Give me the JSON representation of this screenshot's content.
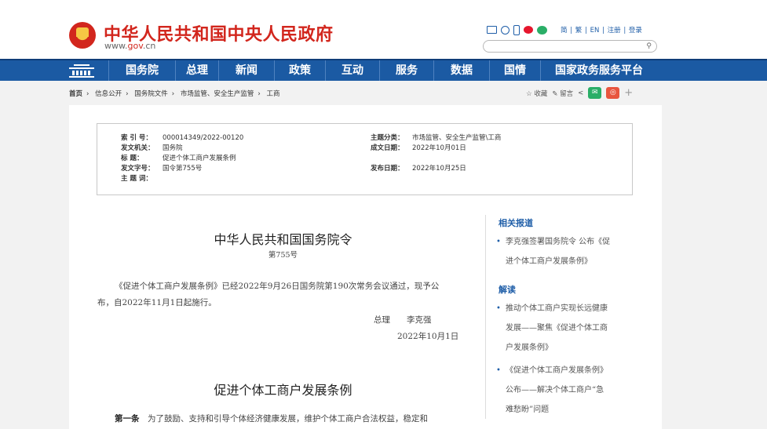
{
  "header": {
    "site_title": "中华人民共和国中央人民政府",
    "site_url_prefix": "www.",
    "site_url_brand": "gov",
    "site_url_suffix": ".cn",
    "top_links": [
      "简",
      "繁",
      "EN",
      "注册",
      "登录"
    ],
    "search_placeholder": ""
  },
  "nav": {
    "items": [
      "国务院",
      "总理",
      "新闻",
      "政策",
      "互动",
      "服务",
      "数据",
      "国情",
      "国家政务服务平台"
    ]
  },
  "breadcrumb": [
    "首页",
    "信息公开",
    "国务院文件",
    "市场监管、安全生产监管",
    "工商"
  ],
  "tools": {
    "favorite": "☆ 收藏",
    "comment": "✎ 留言",
    "share": "<",
    "wechat": "✉",
    "weibo": "◎",
    "more": "+"
  },
  "meta": {
    "index_no_label": "索 引 号：",
    "index_no": "000014349/2022-00120",
    "issuer_label": "发文机关：",
    "issuer": "国务院",
    "title_label": "标    题：",
    "title": "促进个体工商户发展条例",
    "doc_no_label": "发文字号：",
    "doc_no": "国令第755号",
    "keywords_label": "主 题 词：",
    "keywords": "",
    "category_label": "主题分类：",
    "category": "市场监管、安全生产监管\\工商",
    "written_label": "成文日期：",
    "written": "2022年10月01日",
    "published_label": "发布日期：",
    "published": "2022年10月25日"
  },
  "document": {
    "order_title": "中华人民共和国国务院令",
    "order_no": "第755号",
    "intro_line1": "《促进个体工商户发展条例》已经2022年9月26日国务院第190次常务会议通过，现予公",
    "intro_line2": "布，自2022年11月1日起施行。",
    "signer": "总理　　李克强",
    "sign_date": "2022年10月1日",
    "regulation_title": "促进个体工商户发展条例",
    "article1_head": "第一条",
    "article1_text": "　为了鼓励、支持和引导个体经济健康发展，维护个体工商户合法权益，稳定和"
  },
  "sidebar": {
    "related_head": "相关报道",
    "related_items": [
      [
        "李克强签署国务院令 公布《促",
        "进个体工商户发展条例》"
      ]
    ],
    "interpret_head": "解读",
    "interpret_items": [
      [
        "推动个体工商户实现长远健康",
        "发展——聚焦《促进个体工商",
        "户发展条例》"
      ],
      [
        "《促进个体工商户发展条例》",
        "公布——解决个体工商户“急",
        "难愁盼”问题"
      ]
    ]
  },
  "colors": {
    "brand_red": "#d2261d",
    "nav_blue": "#1b5aa3",
    "link_blue": "#1f5ea8"
  }
}
